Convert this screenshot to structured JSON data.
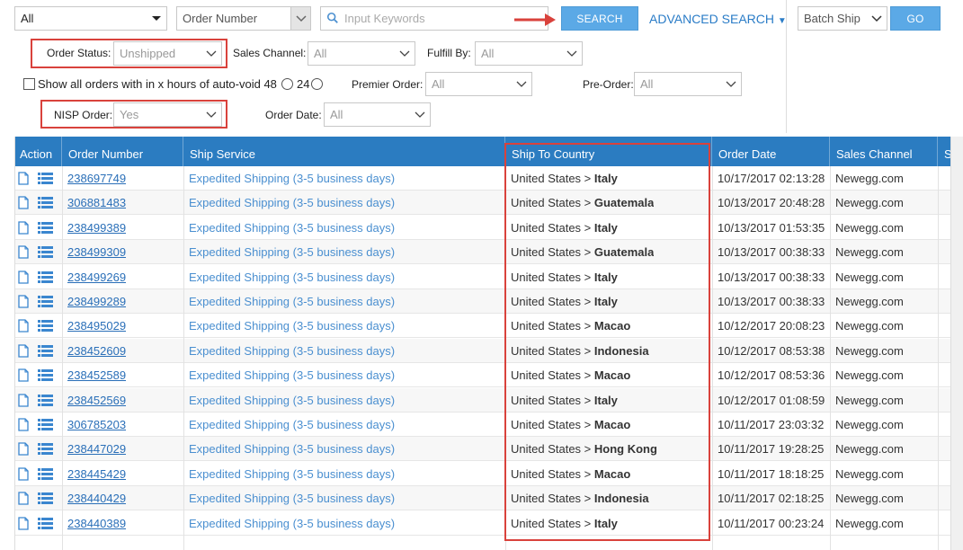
{
  "toolbar": {
    "scope_select": "All",
    "field_select": "Order Number",
    "keyword_placeholder": "Input Keywords",
    "search_label": "SEARCH",
    "advanced_search_label": "ADVANCED SEARCH",
    "batch_select": "Batch Ship",
    "go_label": "GO"
  },
  "filters": {
    "order_status_label": "Order Status:",
    "order_status_value": "Unshipped",
    "sales_channel_label": "Sales Channel:",
    "sales_channel_value": "All",
    "fulfill_by_label": "Fulfill By:",
    "fulfill_by_value": "All",
    "auto_void_label": "Show all orders with in x hours of auto-void 48",
    "auto_void_option": "24",
    "premier_label": "Premier Order:",
    "premier_value": "All",
    "preorder_label": "Pre-Order:",
    "preorder_value": "All",
    "nisp_label": "NISP Order:",
    "nisp_value": "Yes",
    "order_date_label": "Order Date:",
    "order_date_value": "All"
  },
  "table": {
    "headers": [
      "Action",
      "Order Number",
      "Ship Service",
      "Ship To Country",
      "Order Date",
      "Sales Channel",
      "S"
    ],
    "rows": [
      {
        "order": "238697749",
        "service": "Expedited Shipping (3-5 business days)",
        "from": "United States",
        "to": "Italy",
        "date": "10/17/2017 02:13:28",
        "channel": "Newegg.com"
      },
      {
        "order": "306881483",
        "service": "Expedited Shipping (3-5 business days)",
        "from": "United States",
        "to": "Guatemala",
        "date": "10/13/2017 20:48:28",
        "channel": "Newegg.com"
      },
      {
        "order": "238499389",
        "service": "Expedited Shipping (3-5 business days)",
        "from": "United States",
        "to": "Italy",
        "date": "10/13/2017 01:53:35",
        "channel": "Newegg.com"
      },
      {
        "order": "238499309",
        "service": "Expedited Shipping (3-5 business days)",
        "from": "United States",
        "to": "Guatemala",
        "date": "10/13/2017 00:38:33",
        "channel": "Newegg.com"
      },
      {
        "order": "238499269",
        "service": "Expedited Shipping (3-5 business days)",
        "from": "United States",
        "to": "Italy",
        "date": "10/13/2017 00:38:33",
        "channel": "Newegg.com"
      },
      {
        "order": "238499289",
        "service": "Expedited Shipping (3-5 business days)",
        "from": "United States",
        "to": "Italy",
        "date": "10/13/2017 00:38:33",
        "channel": "Newegg.com"
      },
      {
        "order": "238495029",
        "service": "Expedited Shipping (3-5 business days)",
        "from": "United States",
        "to": "Macao",
        "date": "10/12/2017 20:08:23",
        "channel": "Newegg.com"
      },
      {
        "order": "238452609",
        "service": "Expedited Shipping (3-5 business days)",
        "from": "United States",
        "to": "Indonesia",
        "date": "10/12/2017 08:53:38",
        "channel": "Newegg.com"
      },
      {
        "order": "238452589",
        "service": "Expedited Shipping (3-5 business days)",
        "from": "United States",
        "to": "Macao",
        "date": "10/12/2017 08:53:36",
        "channel": "Newegg.com"
      },
      {
        "order": "238452569",
        "service": "Expedited Shipping (3-5 business days)",
        "from": "United States",
        "to": "Italy",
        "date": "10/12/2017 01:08:59",
        "channel": "Newegg.com"
      },
      {
        "order": "306785203",
        "service": "Expedited Shipping (3-5 business days)",
        "from": "United States",
        "to": "Macao",
        "date": "10/11/2017 23:03:32",
        "channel": "Newegg.com"
      },
      {
        "order": "238447029",
        "service": "Expedited Shipping (3-5 business days)",
        "from": "United States",
        "to": "Hong Kong",
        "date": "10/11/2017 19:28:25",
        "channel": "Newegg.com"
      },
      {
        "order": "238445429",
        "service": "Expedited Shipping (3-5 business days)",
        "from": "United States",
        "to": "Macao",
        "date": "10/11/2017 18:18:25",
        "channel": "Newegg.com"
      },
      {
        "order": "238440429",
        "service": "Expedited Shipping (3-5 business days)",
        "from": "United States",
        "to": "Indonesia",
        "date": "10/11/2017 02:18:25",
        "channel": "Newegg.com"
      },
      {
        "order": "238440389",
        "service": "Expedited Shipping (3-5 business days)",
        "from": "United States",
        "to": "Italy",
        "date": "10/11/2017 00:23:24",
        "channel": "Newegg.com"
      }
    ]
  },
  "colors": {
    "header_bg": "#2b7cc1",
    "highlight_border": "#d9423c",
    "button_bg": "#5ba9e6",
    "link": "#2a6fb8"
  }
}
